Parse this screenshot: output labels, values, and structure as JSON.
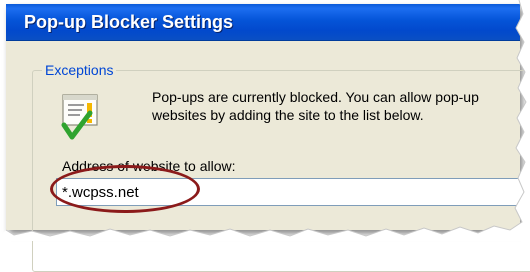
{
  "window": {
    "title": "Pop-up Blocker Settings"
  },
  "exceptions": {
    "legend": "Exceptions",
    "info_icon": "warning-shield-check-icon",
    "info_text": "Pop-ups are currently blocked.  You can allow pop-up\nwebsites by adding the site to the list below.",
    "address_label": "Address of website to allow:",
    "address_value": "*.wcpss.net"
  },
  "colors": {
    "titlebar": "#0554d8",
    "dialog_bg": "#ece9d8",
    "legend_text": "#0046d5",
    "highlight_ellipse": "#8b1a1a"
  }
}
